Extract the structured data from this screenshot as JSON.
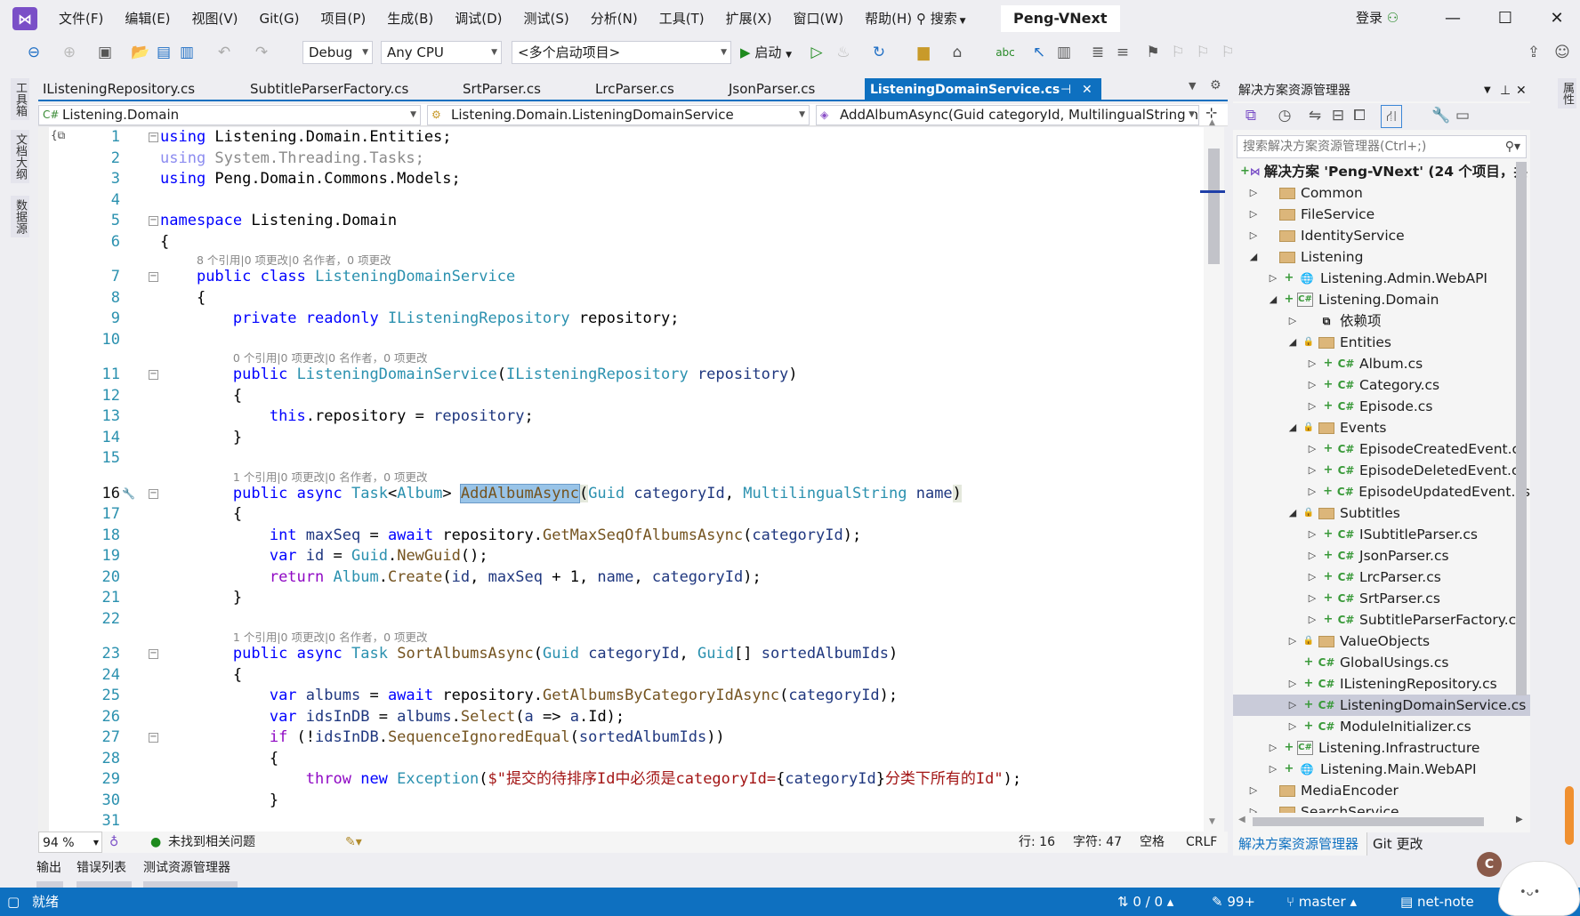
{
  "title_bar": {
    "menu": [
      "文件(F)",
      "编辑(E)",
      "视图(V)",
      "Git(G)",
      "项目(P)",
      "生成(B)",
      "调试(D)",
      "测试(S)",
      "分析(N)",
      "工具(T)",
      "扩展(X)",
      "窗口(W)",
      "帮助(H)"
    ],
    "search": "搜索",
    "solution_name": "Peng-VNext",
    "login": "登录"
  },
  "toolbar": {
    "configuration": "Debug",
    "platform": "Any CPU",
    "startup": "<多个启动项目>",
    "start": "启动"
  },
  "left_strip": [
    "工具箱",
    "文档大纲",
    "数据源"
  ],
  "right_strip": [
    "属性"
  ],
  "tabs": [
    {
      "label": "IListeningRepository.cs"
    },
    {
      "label": "SubtitleParserFactory.cs"
    },
    {
      "label": "SrtParser.cs"
    },
    {
      "label": "LrcParser.cs"
    },
    {
      "label": "JsonParser.cs"
    }
  ],
  "active_tab": "ListeningDomainService.cs",
  "navbar": {
    "project": "Listening.Domain",
    "type": "Listening.Domain.ListeningDomainService",
    "member": "AddAlbumAsync(Guid categoryId, MultilingualString name)"
  },
  "editor": {
    "current_line": 16,
    "lines": [
      {
        "n": 1,
        "fold": "−",
        "t": [
          [
            "kw",
            "using"
          ],
          [
            "pl",
            " Listening.Domain.Entities;"
          ]
        ]
      },
      {
        "n": 2,
        "t": [
          [
            "dimkw",
            "using"
          ],
          [
            "dim",
            " System.Threading.Tasks;"
          ]
        ]
      },
      {
        "n": 3,
        "t": [
          [
            "kw",
            "using"
          ],
          [
            "pl",
            " Peng.Domain.Commons.Models;"
          ]
        ]
      },
      {
        "n": 4,
        "t": []
      },
      {
        "n": 5,
        "fold": "−",
        "t": [
          [
            "kw",
            "namespace"
          ],
          [
            "pl",
            " Listening.Domain"
          ]
        ]
      },
      {
        "n": 6,
        "t": [
          [
            "pl",
            "{"
          ]
        ]
      },
      {
        "lens": "8 个引用|0 项更改|0 名作者，0 项更改",
        "indent": 4
      },
      {
        "n": 7,
        "fold": "−",
        "t": [
          [
            "pl",
            "    "
          ],
          [
            "kw",
            "public"
          ],
          [
            "pl",
            " "
          ],
          [
            "kw",
            "class"
          ],
          [
            "pl",
            " "
          ],
          [
            "ty",
            "ListeningDomainService"
          ]
        ]
      },
      {
        "n": 8,
        "t": [
          [
            "pl",
            "    {"
          ]
        ]
      },
      {
        "n": 9,
        "t": [
          [
            "pl",
            "        "
          ],
          [
            "kw",
            "private"
          ],
          [
            "pl",
            " "
          ],
          [
            "kw",
            "readonly"
          ],
          [
            "pl",
            " "
          ],
          [
            "ty",
            "IListeningRepository"
          ],
          [
            "pl",
            " repository;"
          ]
        ]
      },
      {
        "n": 10,
        "t": []
      },
      {
        "lens": "0 个引用|0 项更改|0 名作者，0 项更改",
        "indent": 8
      },
      {
        "n": 11,
        "fold": "−",
        "t": [
          [
            "pl",
            "        "
          ],
          [
            "kw",
            "public"
          ],
          [
            "pl",
            " "
          ],
          [
            "ty",
            "ListeningDomainService"
          ],
          [
            "pl",
            "("
          ],
          [
            "ty",
            "IListeningRepository"
          ],
          [
            "pl",
            " "
          ],
          [
            "var",
            "repository"
          ],
          [
            "pl",
            ")"
          ]
        ]
      },
      {
        "n": 12,
        "t": [
          [
            "pl",
            "        {"
          ]
        ]
      },
      {
        "n": 13,
        "t": [
          [
            "pl",
            "            "
          ],
          [
            "kw",
            "this"
          ],
          [
            "pl",
            ".repository = "
          ],
          [
            "var",
            "repository"
          ],
          [
            "pl",
            ";"
          ]
        ]
      },
      {
        "n": 14,
        "t": [
          [
            "pl",
            "        }"
          ]
        ]
      },
      {
        "n": 15,
        "t": []
      },
      {
        "lens": "1 个引用|0 项更改|0 名作者，0 项更改",
        "indent": 8
      },
      {
        "n": 16,
        "fold": "−",
        "t": [
          [
            "pl",
            "        "
          ],
          [
            "kw",
            "public"
          ],
          [
            "pl",
            " "
          ],
          [
            "kw",
            "async"
          ],
          [
            "pl",
            " "
          ],
          [
            "ty",
            "Task"
          ],
          [
            "pl",
            "<"
          ],
          [
            "ty",
            "Album"
          ],
          [
            "pl",
            "> "
          ],
          [
            "fn hl",
            "AddAlbumAsync"
          ],
          [
            "pl pm",
            "("
          ],
          [
            "ty",
            "Guid"
          ],
          [
            "pl",
            " "
          ],
          [
            "var",
            "categoryId"
          ],
          [
            "pl",
            ", "
          ],
          [
            "ty",
            "MultilingualString"
          ],
          [
            "pl",
            " "
          ],
          [
            "var",
            "name"
          ],
          [
            "pl pm",
            ")"
          ]
        ]
      },
      {
        "n": 17,
        "t": [
          [
            "pl",
            "        {"
          ]
        ]
      },
      {
        "n": 18,
        "t": [
          [
            "pl",
            "            "
          ],
          [
            "kw",
            "int"
          ],
          [
            "pl",
            " "
          ],
          [
            "var",
            "maxSeq"
          ],
          [
            "pl",
            " = "
          ],
          [
            "kw",
            "await"
          ],
          [
            "pl",
            " repository."
          ],
          [
            "fn",
            "GetMaxSeqOfAlbumsAsync"
          ],
          [
            "pl",
            "("
          ],
          [
            "var",
            "categoryId"
          ],
          [
            "pl",
            ");"
          ]
        ]
      },
      {
        "n": 19,
        "t": [
          [
            "pl",
            "            "
          ],
          [
            "kw",
            "var"
          ],
          [
            "pl",
            " "
          ],
          [
            "var",
            "id"
          ],
          [
            "pl",
            " = "
          ],
          [
            "ty",
            "Guid"
          ],
          [
            "pl",
            "."
          ],
          [
            "fn",
            "NewGuid"
          ],
          [
            "pl",
            "();"
          ]
        ]
      },
      {
        "n": 20,
        "t": [
          [
            "pl",
            "            "
          ],
          [
            "ctl",
            "return"
          ],
          [
            "pl",
            " "
          ],
          [
            "ty",
            "Album"
          ],
          [
            "pl",
            "."
          ],
          [
            "fn",
            "Create"
          ],
          [
            "pl",
            "("
          ],
          [
            "var",
            "id"
          ],
          [
            "pl",
            ", "
          ],
          [
            "var",
            "maxSeq"
          ],
          [
            "pl",
            " + 1, "
          ],
          [
            "var",
            "name"
          ],
          [
            "pl",
            ", "
          ],
          [
            "var",
            "categoryId"
          ],
          [
            "pl",
            ");"
          ]
        ]
      },
      {
        "n": 21,
        "t": [
          [
            "pl",
            "        }"
          ]
        ]
      },
      {
        "n": 22,
        "t": []
      },
      {
        "lens": "1 个引用|0 项更改|0 名作者，0 项更改",
        "indent": 8
      },
      {
        "n": 23,
        "fold": "−",
        "t": [
          [
            "pl",
            "        "
          ],
          [
            "kw",
            "public"
          ],
          [
            "pl",
            " "
          ],
          [
            "kw",
            "async"
          ],
          [
            "pl",
            " "
          ],
          [
            "ty",
            "Task"
          ],
          [
            "pl",
            " "
          ],
          [
            "fn",
            "SortAlbumsAsync"
          ],
          [
            "pl",
            "("
          ],
          [
            "ty",
            "Guid"
          ],
          [
            "pl",
            " "
          ],
          [
            "var",
            "categoryId"
          ],
          [
            "pl",
            ", "
          ],
          [
            "ty",
            "Guid"
          ],
          [
            "pl",
            "[] "
          ],
          [
            "var",
            "sortedAlbumIds"
          ],
          [
            "pl",
            ")"
          ]
        ]
      },
      {
        "n": 24,
        "t": [
          [
            "pl",
            "        {"
          ]
        ]
      },
      {
        "n": 25,
        "t": [
          [
            "pl",
            "            "
          ],
          [
            "kw",
            "var"
          ],
          [
            "pl",
            " "
          ],
          [
            "var",
            "albums"
          ],
          [
            "pl",
            " = "
          ],
          [
            "kw",
            "await"
          ],
          [
            "pl",
            " repository."
          ],
          [
            "fn",
            "GetAlbumsByCategoryIdAsync"
          ],
          [
            "pl",
            "("
          ],
          [
            "var",
            "categoryId"
          ],
          [
            "pl",
            ");"
          ]
        ]
      },
      {
        "n": 26,
        "t": [
          [
            "pl",
            "            "
          ],
          [
            "kw",
            "var"
          ],
          [
            "pl",
            " "
          ],
          [
            "var",
            "idsInDB"
          ],
          [
            "pl",
            " = "
          ],
          [
            "var",
            "albums"
          ],
          [
            "pl",
            "."
          ],
          [
            "fn",
            "Select"
          ],
          [
            "pl",
            "("
          ],
          [
            "var",
            "a"
          ],
          [
            "pl",
            " => "
          ],
          [
            "var",
            "a"
          ],
          [
            "pl",
            ".Id);"
          ]
        ]
      },
      {
        "n": 27,
        "fold": "−",
        "t": [
          [
            "pl",
            "            "
          ],
          [
            "ctl",
            "if"
          ],
          [
            "pl",
            " (!"
          ],
          [
            "var",
            "idsInDB"
          ],
          [
            "pl",
            "."
          ],
          [
            "fn",
            "SequenceIgnoredEqual"
          ],
          [
            "pl",
            "("
          ],
          [
            "var",
            "sortedAlbumIds"
          ],
          [
            "pl",
            "))"
          ]
        ]
      },
      {
        "n": 28,
        "t": [
          [
            "pl",
            "            {"
          ]
        ]
      },
      {
        "n": 29,
        "t": [
          [
            "pl",
            "                "
          ],
          [
            "ctl",
            "throw"
          ],
          [
            "pl",
            " "
          ],
          [
            "kw",
            "new"
          ],
          [
            "pl",
            " "
          ],
          [
            "ty",
            "Exception"
          ],
          [
            "pl",
            "("
          ],
          [
            "str",
            "$\"提交的待排序Id中必须是categoryId="
          ],
          [
            "pl",
            "{"
          ],
          [
            "var",
            "categoryId"
          ],
          [
            "pl",
            "}"
          ],
          [
            "str",
            "分类下所有的Id\""
          ],
          [
            "pl",
            ");"
          ]
        ]
      },
      {
        "n": 30,
        "t": [
          [
            "pl",
            "            }"
          ]
        ]
      },
      {
        "n": 31,
        "t": []
      }
    ]
  },
  "editor_status": {
    "zoom": "94 %",
    "issues": "未找到相关问题",
    "line": "行: 16",
    "char": "字符: 47",
    "spacing": "空格",
    "eol": "CRLF"
  },
  "bottom_tabs": [
    "输出",
    "错误列表",
    "测试资源管理器"
  ],
  "status_bar": {
    "ready": "就绪",
    "sync": "0 / 0",
    "changes": "99+",
    "branch": "master",
    "repo": "net-note"
  },
  "solution_explorer": {
    "title": "解决方案资源管理器",
    "search_placeholder": "搜索解决方案资源管理器(Ctrl+;)",
    "tree": [
      {
        "level": 0,
        "exp": "",
        "mk": "plus",
        "icon": "sln",
        "label": "解决方案 'Peng-VNext' (24 个项目，共 2",
        "bold": true
      },
      {
        "level": 0,
        "exp": "▷",
        "icon": "folder",
        "label": "Common"
      },
      {
        "level": 0,
        "exp": "▷",
        "icon": "folder",
        "label": "FileService"
      },
      {
        "level": 0,
        "exp": "▷",
        "icon": "folder",
        "label": "IdentityService"
      },
      {
        "level": 0,
        "exp": "◢",
        "icon": "folder",
        "label": "Listening"
      },
      {
        "level": 1,
        "exp": "▷",
        "mk": "plus",
        "icon": "web",
        "label": "Listening.Admin.WebAPI"
      },
      {
        "level": 1,
        "exp": "◢",
        "mk": "plus",
        "icon": "proj",
        "label": "Listening.Domain"
      },
      {
        "level": 2,
        "exp": "▷",
        "icon": "deps",
        "label": "依赖项"
      },
      {
        "level": 2,
        "exp": "◢",
        "mk": "lock",
        "icon": "folder",
        "label": "Entities"
      },
      {
        "level": 3,
        "exp": "▷",
        "mk": "plus",
        "icon": "cs",
        "label": "Album.cs"
      },
      {
        "level": 3,
        "exp": "▷",
        "mk": "plus",
        "icon": "cs",
        "label": "Category.cs"
      },
      {
        "level": 3,
        "exp": "▷",
        "mk": "plus",
        "icon": "cs",
        "label": "Episode.cs"
      },
      {
        "level": 2,
        "exp": "◢",
        "mk": "lock",
        "icon": "folder",
        "label": "Events"
      },
      {
        "level": 3,
        "exp": "▷",
        "mk": "plus",
        "icon": "cs",
        "label": "EpisodeCreatedEvent.cs"
      },
      {
        "level": 3,
        "exp": "▷",
        "mk": "plus",
        "icon": "cs",
        "label": "EpisodeDeletedEvent.cs"
      },
      {
        "level": 3,
        "exp": "▷",
        "mk": "plus",
        "icon": "cs",
        "label": "EpisodeUpdatedEvent.cs"
      },
      {
        "level": 2,
        "exp": "◢",
        "mk": "lock",
        "icon": "folder",
        "label": "Subtitles"
      },
      {
        "level": 3,
        "exp": "▷",
        "mk": "plus",
        "icon": "cs",
        "label": "ISubtitleParser.cs"
      },
      {
        "level": 3,
        "exp": "▷",
        "mk": "plus",
        "icon": "cs",
        "label": "JsonParser.cs"
      },
      {
        "level": 3,
        "exp": "▷",
        "mk": "plus",
        "icon": "cs",
        "label": "LrcParser.cs"
      },
      {
        "level": 3,
        "exp": "▷",
        "mk": "plus",
        "icon": "cs",
        "label": "SrtParser.cs"
      },
      {
        "level": 3,
        "exp": "▷",
        "mk": "plus",
        "icon": "cs",
        "label": "SubtitleParserFactory.cs"
      },
      {
        "level": 2,
        "exp": "▷",
        "mk": "lock",
        "icon": "folder",
        "label": "ValueObjects"
      },
      {
        "level": 2,
        "exp": "",
        "mk": "plus",
        "icon": "cs",
        "label": "GlobalUsings.cs",
        "noexp": true
      },
      {
        "level": 2,
        "exp": "▷",
        "mk": "plus",
        "icon": "cs",
        "label": "IListeningRepository.cs"
      },
      {
        "level": 2,
        "exp": "▷",
        "mk": "plus",
        "icon": "cs",
        "label": "ListeningDomainService.cs",
        "selected": true
      },
      {
        "level": 2,
        "exp": "▷",
        "mk": "plus",
        "icon": "cs",
        "label": "ModuleInitializer.cs"
      },
      {
        "level": 1,
        "exp": "▷",
        "mk": "plus",
        "icon": "proj",
        "label": "Listening.Infrastructure"
      },
      {
        "level": 1,
        "exp": "▷",
        "mk": "plus",
        "icon": "web",
        "label": "Listening.Main.WebAPI"
      },
      {
        "level": 0,
        "exp": "▷",
        "icon": "folder",
        "label": "MediaEncoder"
      },
      {
        "level": 0,
        "exp": "▷",
        "icon": "folder",
        "label": "SearchService"
      }
    ],
    "tabs": [
      "解决方案资源管理器",
      "Git 更改"
    ]
  },
  "colors": {
    "accent": "#0e70c0",
    "keyword": "#0000ff",
    "type": "#2b91af",
    "method": "#74531f",
    "string": "#a31515",
    "control": "#8f08c4",
    "variable": "#1f377f"
  }
}
